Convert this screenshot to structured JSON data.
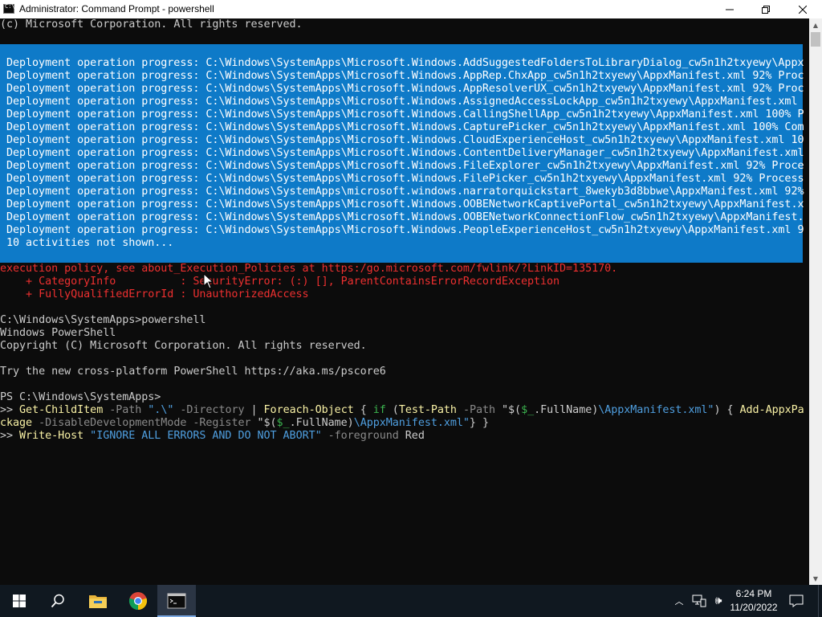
{
  "window": {
    "title": "Administrator: Command Prompt - powershell",
    "minimize_icon": "minimize-icon",
    "maximize_icon": "restore-icon",
    "close_icon": "close-icon"
  },
  "console": {
    "top_line": "(c) Microsoft Corporation. All rights reserved.",
    "progress_lines": [
      "Deployment operation progress: C:\\Windows\\SystemApps\\Microsoft.Windows.AddSuggestedFoldersToLibraryDialog_cw5n1h2txyewy\\Appx",
      "Deployment operation progress: C:\\Windows\\SystemApps\\Microsoft.Windows.AppRep.ChxApp_cw5n1h2txyewy\\AppxManifest.xml 92% Proc",
      "Deployment operation progress: C:\\Windows\\SystemApps\\Microsoft.Windows.AppResolverUX_cw5n1h2txyewy\\AppxManifest.xml 92% Proc",
      "Deployment operation progress: C:\\Windows\\SystemApps\\Microsoft.Windows.AssignedAccessLockApp_cw5n1h2txyewy\\AppxManifest.xml",
      "Deployment operation progress: C:\\Windows\\SystemApps\\Microsoft.Windows.CallingShellApp_cw5n1h2txyewy\\AppxManifest.xml 100% P",
      "Deployment operation progress: C:\\Windows\\SystemApps\\Microsoft.Windows.CapturePicker_cw5n1h2txyewy\\AppxManifest.xml 100% Com",
      "Deployment operation progress: C:\\Windows\\SystemApps\\Microsoft.Windows.CloudExperienceHost_cw5n1h2txyewy\\AppxManifest.xml 10",
      "Deployment operation progress: C:\\Windows\\SystemApps\\Microsoft.Windows.ContentDeliveryManager_cw5n1h2txyewy\\AppxManifest.xml",
      "Deployment operation progress: C:\\Windows\\SystemApps\\Microsoft.Windows.FileExplorer_cw5n1h2txyewy\\AppxManifest.xml 92% Proce",
      "Deployment operation progress: C:\\Windows\\SystemApps\\Microsoft.Windows.FilePicker_cw5n1h2txyewy\\AppxManifest.xml 92% Process",
      "Deployment operation progress: C:\\Windows\\SystemApps\\microsoft.windows.narratorquickstart_8wekyb3d8bbwe\\AppxManifest.xml 92%",
      "Deployment operation progress: C:\\Windows\\SystemApps\\Microsoft.Windows.OOBENetworkCaptivePortal_cw5n1h2txyewy\\AppxManifest.x",
      "Deployment operation progress: C:\\Windows\\SystemApps\\Microsoft.Windows.OOBENetworkConnectionFlow_cw5n1h2txyewy\\AppxManifest.",
      "Deployment operation progress: C:\\Windows\\SystemApps\\Microsoft.Windows.PeopleExperienceHost_cw5n1h2txyewy\\AppxManifest.xml 9",
      "10 activities not shown..."
    ],
    "error_lines": [
      "execution policy, see about_Execution_Policies at https:/go.microsoft.com/fwlink/?LinkID=135170.",
      "    + CategoryInfo          : SecurityError: (:) [], ParentContainsErrorRecordException",
      "    + FullyQualifiedErrorId : UnauthorizedAccess"
    ],
    "output_lines": [
      "C:\\Windows\\SystemApps>powershell",
      "Windows PowerShell",
      "Copyright (C) Microsoft Corporation. All rights reserved.",
      "Try the new cross-platform PowerShell https://aka.ms/pscore6",
      "PS C:\\Windows\\SystemApps>"
    ],
    "command": {
      "prompt": ">> ",
      "cmd1": "Get-ChildItem",
      "p_path": " -Path ",
      "s_dot": "\".\\\"",
      "p_dir": " -Directory",
      "pipe": " | ",
      "cmd2": "Foreach-Object",
      "brace1": " { ",
      "kw_if": "if",
      "paren_open": " (",
      "cmd3": "Test-Path",
      "p_path2": " -Path ",
      "s_q1": "\"$(",
      "var1": "$_",
      "s_full1": ".FullName)",
      "s_manifest1": "\\AppxManifest.xml\"",
      "brace2": ") { ",
      "cmd4": "Add-AppxPa",
      "cont": "ckage",
      "p_disable": " -DisableDevelopmentMode",
      "p_register": " -Register",
      "space": " ",
      "s_q2": "\"$(",
      "var2": "$_",
      "s_full2": ".FullName)",
      "s_manifest2": "\\AppxManifest.xml\"",
      "close": "} }",
      "cmd5": "Write-Host",
      "s_msg": " \"IGNORE ALL ERRORS AND DO NOT ABORT\"",
      "p_fg": " -foreground",
      "red": " Red"
    }
  },
  "taskbar": {
    "start_icon": "windows-logo-icon",
    "search_icon": "search-icon",
    "apps": [
      "file-explorer-icon",
      "chrome-icon",
      "command-prompt-icon"
    ],
    "time": "6:24 PM",
    "date": "11/20/2022",
    "colors": {
      "taskbar": "#101820",
      "active": "#2b3544",
      "progress_bg": "#0e7ac8",
      "error": "#ef3030"
    }
  }
}
